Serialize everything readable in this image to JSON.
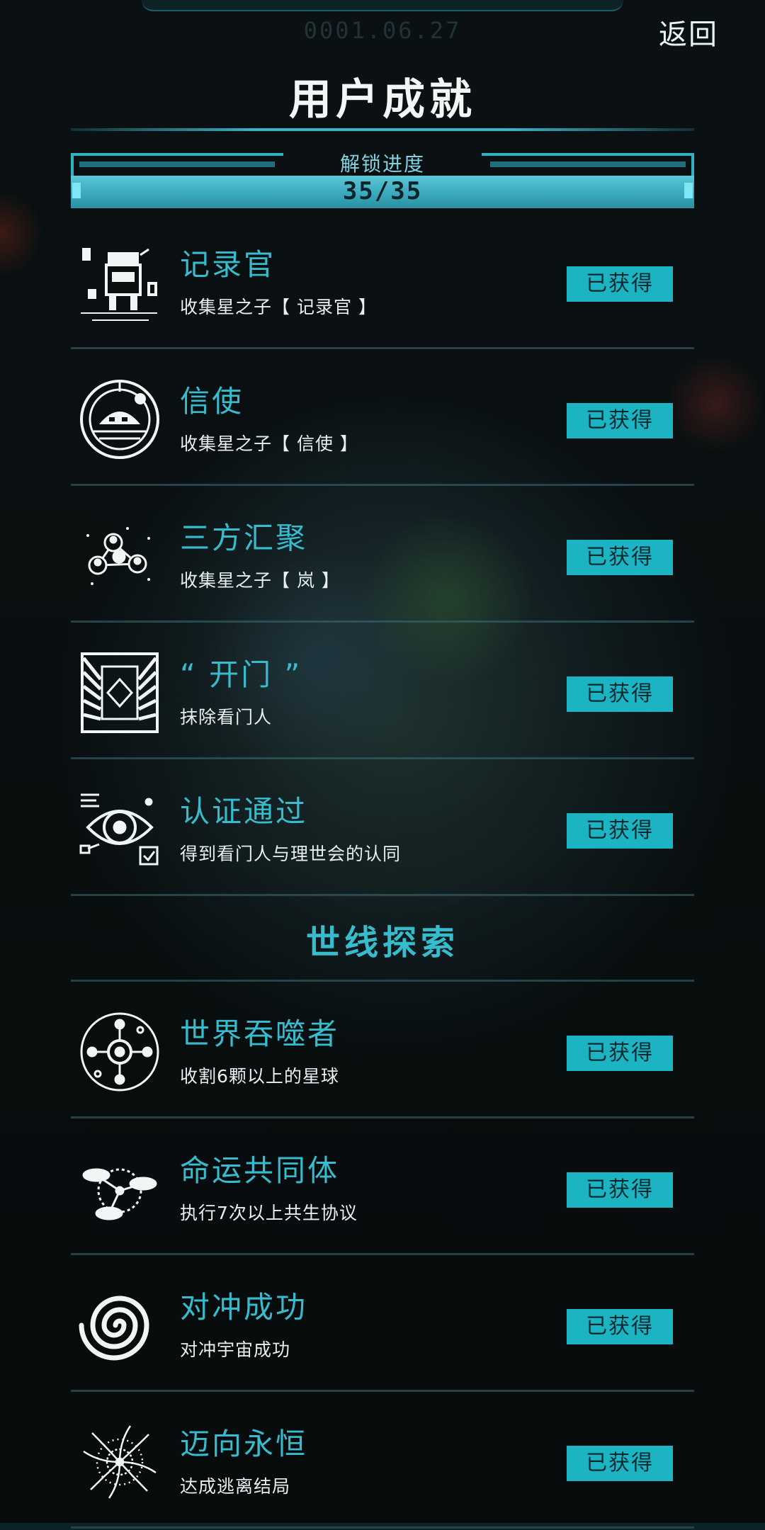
{
  "header": {
    "date": "0001.06.27",
    "back_label": "返回",
    "title": "用户成就"
  },
  "progress": {
    "label": "解锁进度",
    "value_text": "35/35",
    "fraction": 1.0
  },
  "achievements_main": [
    {
      "name": "记录官",
      "desc": "收集星之子【 记录官 】",
      "status": "已获得",
      "icon": "recorder-robot-icon"
    },
    {
      "name": "信使",
      "desc": "收集星之子【 信使 】",
      "status": "已获得",
      "icon": "messenger-orb-icon"
    },
    {
      "name": "三方汇聚",
      "desc": "收集星之子【 岚 】",
      "status": "已获得",
      "icon": "convergence-nodes-icon"
    },
    {
      "name": "“ 开门 ”",
      "desc": "抹除看门人",
      "status": "已获得",
      "icon": "gate-icon"
    },
    {
      "name": "认证通过",
      "desc": "得到看门人与理世会的认同",
      "status": "已获得",
      "icon": "verified-eye-icon"
    }
  ],
  "section_title": "世线探索",
  "achievements_world": [
    {
      "name": "世界吞噬者",
      "desc": "收割6颗以上的星球",
      "status": "已获得",
      "icon": "world-devourer-icon"
    },
    {
      "name": "命运共同体",
      "desc": "执行7次以上共生协议",
      "status": "已获得",
      "icon": "linked-planets-icon"
    },
    {
      "name": "对冲成功",
      "desc": "对冲宇宙成功",
      "status": "已获得",
      "icon": "spiral-vortex-icon"
    },
    {
      "name": "迈向永恒",
      "desc": "达成逃离结局",
      "status": "已获得",
      "icon": "galaxy-swirl-icon"
    }
  ],
  "colors": {
    "accent": "#37bccd",
    "badge_bg": "#1cb3c3",
    "background": "#070b0c"
  }
}
